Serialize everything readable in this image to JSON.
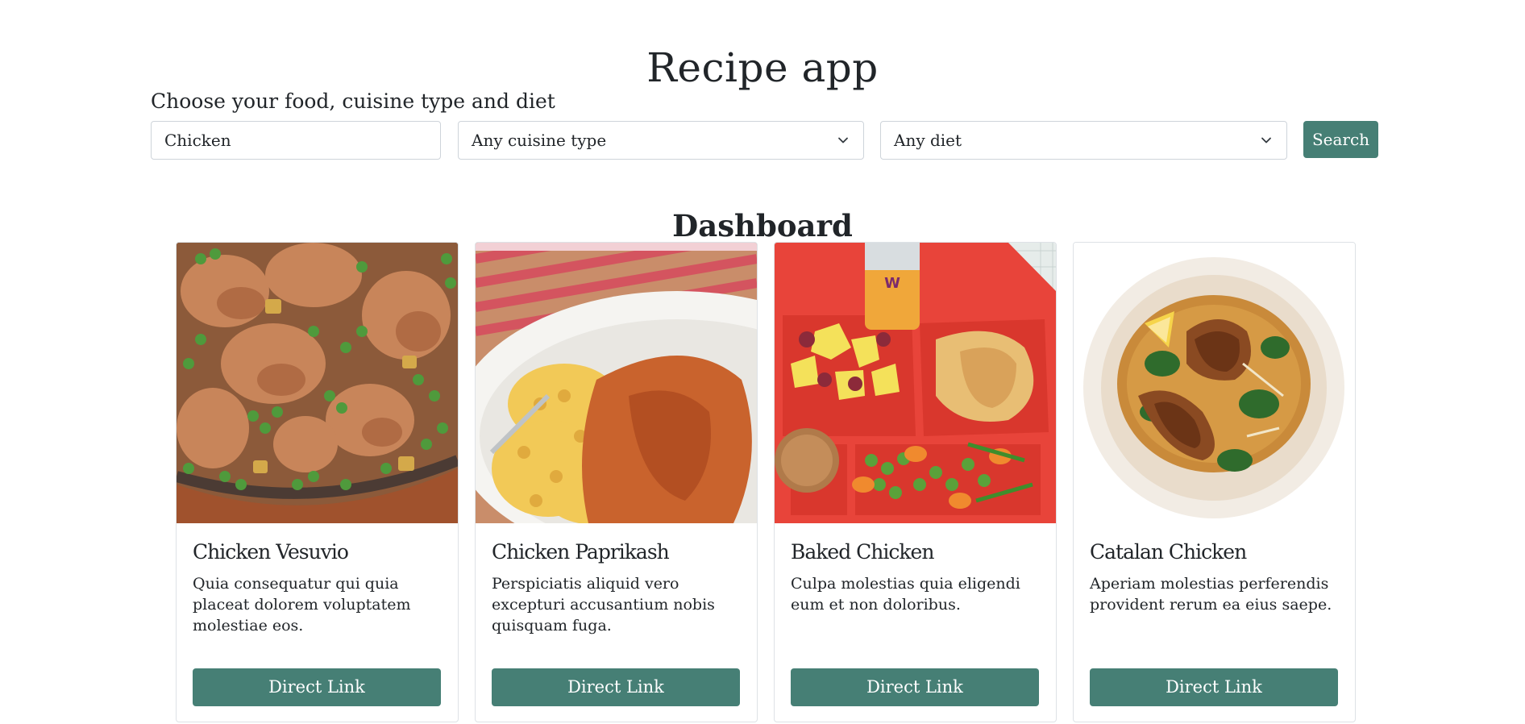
{
  "header": {
    "title": "Recipe app"
  },
  "search": {
    "label": "Choose your food, cuisine type and diet",
    "food_value": "Chicken",
    "cuisine_selected": "Any cuisine type",
    "diet_selected": "Any diet",
    "button_label": "Search"
  },
  "dashboard": {
    "title": "Dashboard",
    "cards": [
      {
        "title": "Chicken Vesuvio",
        "text": "Quia consequatur qui quia placeat dolorem voluptatem molestiae eos.",
        "button": "Direct Link"
      },
      {
        "title": "Chicken Paprikash",
        "text": "Perspiciatis aliquid vero excepturi accusantium nobis quisquam fuga.",
        "button": "Direct Link"
      },
      {
        "title": "Baked Chicken",
        "text": "Culpa molestias quia eligendi eum et non doloribus.",
        "button": "Direct Link"
      },
      {
        "title": "Catalan Chicken",
        "text": "Aperiam molestias perferendis provident rerum ea eius saepe.",
        "button": "Direct Link"
      }
    ]
  },
  "colors": {
    "accent": "#467f75",
    "border": "#dee2e6",
    "text": "#212529"
  },
  "icons": {
    "select_chevron": "chevron-down-icon"
  }
}
